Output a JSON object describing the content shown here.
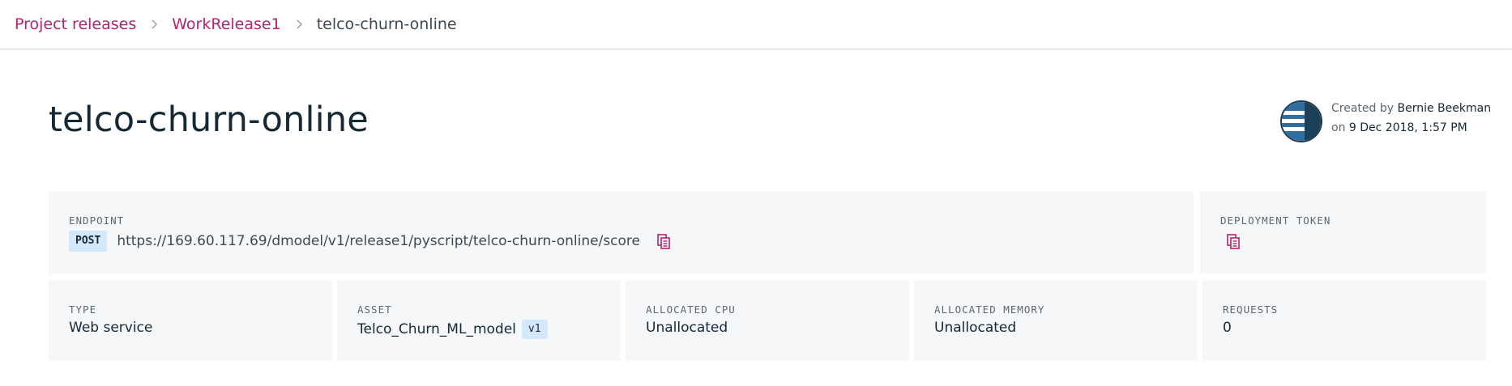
{
  "breadcrumb": {
    "items": [
      {
        "label": "Project releases"
      },
      {
        "label": "WorkRelease1"
      },
      {
        "label": "telco-churn-online"
      }
    ]
  },
  "page": {
    "title": "telco-churn-online"
  },
  "creator": {
    "created_by_prefix": "Created by",
    "name": "Bernie Beekman",
    "on_prefix": "on",
    "date": "9 Dec 2018, 1:57 PM"
  },
  "endpoint": {
    "label": "ENDPOINT",
    "method": "POST",
    "url": "https://169.60.117.69/dmodel/v1/release1/pyscript/telco-churn-online/score",
    "copy_icon": "copy-icon"
  },
  "deployment_token": {
    "label": "DEPLOYMENT TOKEN",
    "copy_icon": "copy-icon"
  },
  "details": {
    "type": {
      "label": "TYPE",
      "value": "Web service"
    },
    "asset": {
      "label": "ASSET",
      "value": "Telco_Churn_ML_model",
      "version": "v1"
    },
    "cpu": {
      "label": "ALLOCATED CPU",
      "value": "Unallocated"
    },
    "memory": {
      "label": "ALLOCATED MEMORY",
      "value": "Unallocated"
    },
    "requests": {
      "label": "REQUESTS",
      "value": "0"
    }
  },
  "colors": {
    "link": "#b4236c",
    "text": "#152935",
    "card_bg": "#f6f7f9",
    "tag_bg": "#d3e9fb"
  }
}
